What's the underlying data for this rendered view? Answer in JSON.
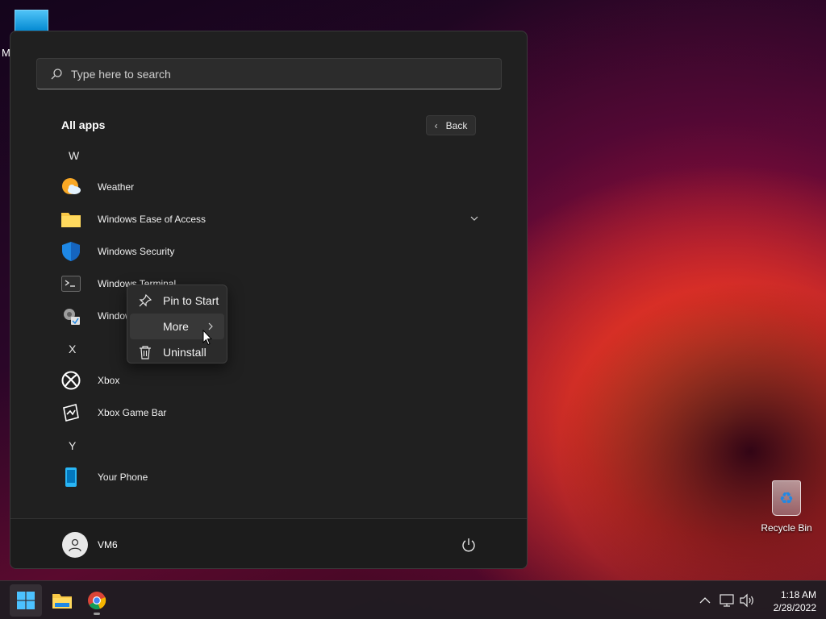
{
  "desktop": {
    "partial_label": "M",
    "recycle_bin_label": "Recycle Bin"
  },
  "start_menu": {
    "search_placeholder": "Type here to search",
    "all_apps_label": "All apps",
    "back_label": "Back",
    "sections": [
      {
        "letter": "W"
      },
      {
        "letter": "X"
      },
      {
        "letter": "Y"
      }
    ],
    "apps": [
      {
        "label": "Weather",
        "icon": "weather-icon"
      },
      {
        "label": "Windows Ease of Access",
        "icon": "folder-icon"
      },
      {
        "label": "Windows Security",
        "icon": "shield-icon"
      },
      {
        "label": "Windows Terminal",
        "icon": "terminal-icon"
      },
      {
        "label": "Windows Tools",
        "icon": "tools-icon"
      },
      {
        "label": "Xbox",
        "icon": "xbox-icon"
      },
      {
        "label": "Xbox Game Bar",
        "icon": "game-bar-icon"
      },
      {
        "label": "Your Phone",
        "icon": "phone-icon"
      }
    ],
    "user": {
      "name": "VM6"
    }
  },
  "context_menu": {
    "items": [
      {
        "label": "Pin to Start",
        "icon": "pin-icon"
      },
      {
        "label": "More",
        "icon": "",
        "hovered": true
      },
      {
        "label": "Uninstall",
        "icon": "trash-icon"
      }
    ]
  },
  "taskbar": {
    "time": "1:18 AM",
    "date": "2/28/2022"
  },
  "colors": {
    "accent": "#0078d4",
    "menu_bg": "#202020",
    "context_bg": "#2b2b2b"
  }
}
